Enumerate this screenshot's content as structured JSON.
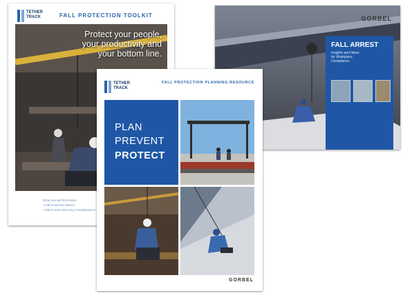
{
  "toolkit": {
    "header": "FALL PROTECTION TOOLKIT",
    "logo": "TETHER TRACK",
    "headline": [
      "Protect your people,",
      "your productivity and",
      "your bottom line."
    ],
    "footer": [
      "What you will find inside:",
      "• Fall Protection Basics",
      "• OSHA and ANSI Key Considerations"
    ]
  },
  "arrest": {
    "brand": "GORBEL",
    "title": "FALL ARREST",
    "subtitle": [
      "Insights and Ideas",
      "for Workplace",
      "Compliance"
    ]
  },
  "planning": {
    "header": "FALL PROTECTION PLANNING RESOURCE",
    "logo": "TETHER TRACK",
    "words": [
      "PLAN",
      "PREVENT",
      "PROTECT"
    ],
    "brand": "GORBEL"
  },
  "colors": {
    "accent_blue": "#1f57a6",
    "header_blue": "#2a66a8"
  }
}
